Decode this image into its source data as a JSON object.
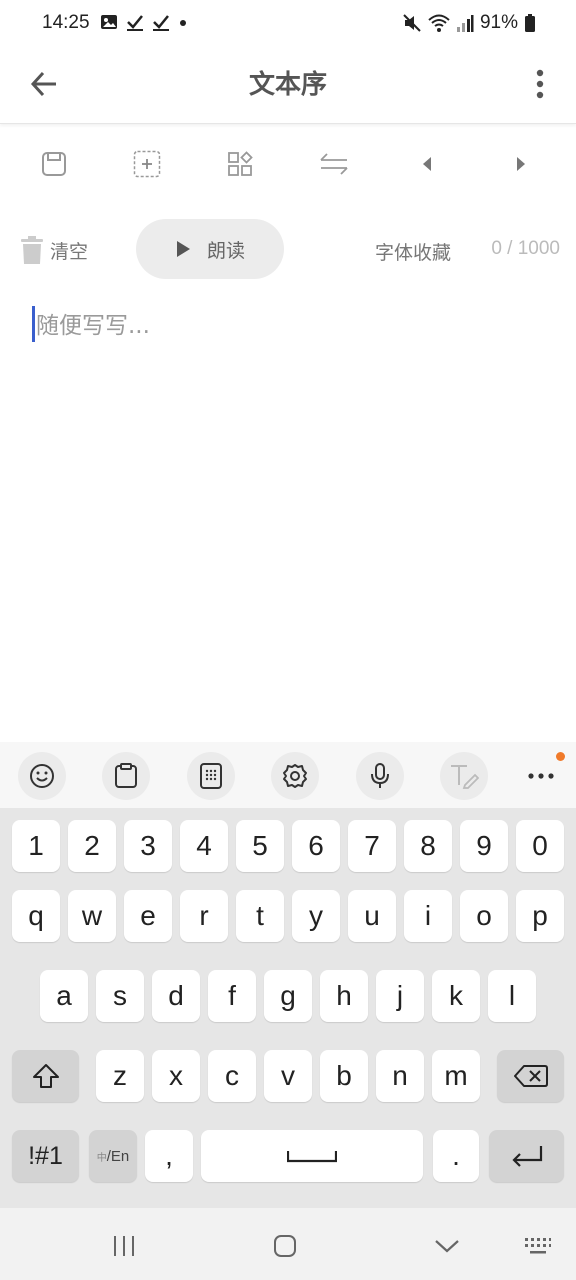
{
  "status": {
    "time": "14:25",
    "battery": "91%",
    "left_icons": [
      "image-icon",
      "check-icon",
      "check-icon",
      "dot-icon"
    ],
    "right_icons": [
      "mute-icon",
      "wifi-icon",
      "signal-icon",
      "battery-icon"
    ]
  },
  "app_bar": {
    "title": "文本序",
    "back_icon": "arrow-left-icon",
    "more_icon": "more-vertical-icon"
  },
  "toolbar": {
    "tools": [
      "save-icon",
      "add-box-icon",
      "grid-shapes-icon",
      "swap-icon",
      "triangle-left-icon",
      "triangle-right-icon"
    ]
  },
  "actions": {
    "clear_label": "清空",
    "read_label": "朗读",
    "font_fav_label": "字体收藏",
    "counter": "0 / 1000"
  },
  "editor": {
    "placeholder": "随便写写..."
  },
  "keyboard": {
    "toolbar": [
      "emoji-icon",
      "clipboard-icon",
      "keypad-icon",
      "settings-icon",
      "mic-icon",
      "text-edit-icon",
      "more-horizontal-icon"
    ],
    "accent_color": "#f07a2a",
    "row_numbers": [
      "1",
      "2",
      "3",
      "4",
      "5",
      "6",
      "7",
      "8",
      "9",
      "0"
    ],
    "row_top": [
      "q",
      "w",
      "e",
      "r",
      "t",
      "y",
      "u",
      "i",
      "o",
      "p"
    ],
    "row_mid": [
      "a",
      "s",
      "d",
      "f",
      "g",
      "h",
      "j",
      "k",
      "l"
    ],
    "row_bottom": [
      "z",
      "x",
      "c",
      "v",
      "b",
      "n",
      "m"
    ],
    "symbols_label": "!#1",
    "lang_small": "中",
    "lang_main": "/En",
    "comma": ",",
    "period": "."
  },
  "nav": [
    "recent-apps-icon",
    "home-icon",
    "back-chevron-icon",
    "keyboard-icon"
  ]
}
